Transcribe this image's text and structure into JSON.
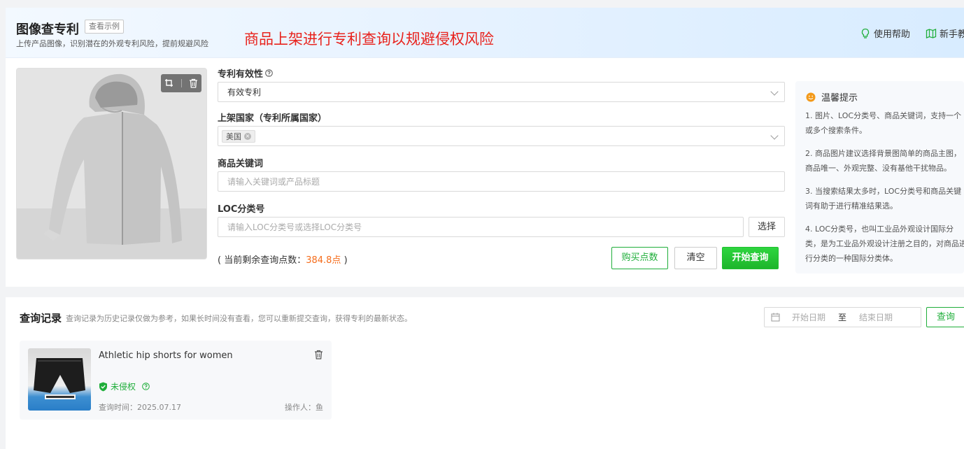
{
  "header": {
    "title": "图像查专利",
    "example_label": "查看示例",
    "subtitle": "上传产品图像，识别潜在的外观专利风险，提前规避风险",
    "banner": "商品上架进行专利查询以规避侵权风险",
    "help_label": "使用帮助",
    "guide_label": "新手教"
  },
  "form": {
    "validity_label": "专利有效性",
    "validity_value": "有效专利",
    "country_label": "上架国家（专利所属国家）",
    "country_tag": "美国",
    "keyword_label": "商品关键词",
    "keyword_placeholder": "请输入关键词或产品标题",
    "loc_label": "LOC分类号",
    "loc_placeholder": "请输入LOC分类号或选择LOC分类号",
    "select_label": "选择",
    "points_prefix": "( 当前剩余查询点数：",
    "points_value": "384.8点",
    "points_suffix": " )",
    "buy_label": "购买点数",
    "clear_label": "清空",
    "start_label": "开始查询"
  },
  "tips": {
    "title": "温馨提示",
    "items": [
      "1. 图片、LOC分类号、商品关键词，支持一个或多个搜索条件。",
      "2. 商品图片建议选择背景图简单的商品主图，商品唯一、外观完整、没有基他干扰物品。",
      "3. 当搜索结果太多时，LOC分类号和商品关键词有助于进行精准结果选。",
      "4. LOC分类号，也叫工业品外观设计国际分类，是为工业品外观设计注册之目的，对商品进行分类的一种国际分类体。"
    ]
  },
  "records": {
    "title": "查询记录",
    "description": "查询记录为历史记录仅做为参考，如果长时间没有查看，您可以重新提交查询，获得专利的最新状态。",
    "start_placeholder": "开始日期",
    "to_label": "至",
    "end_placeholder": "结束日期",
    "query_label": "查询",
    "items": [
      {
        "name": "Athletic hip shorts for women",
        "status": "未侵权",
        "time": "查询时间：2025.07.17",
        "operator": "操作人：鱼"
      }
    ]
  },
  "colors": {
    "brand_green": "#1fae3a",
    "banner_red": "#e8231d",
    "points_orange": "#f56c1b"
  }
}
